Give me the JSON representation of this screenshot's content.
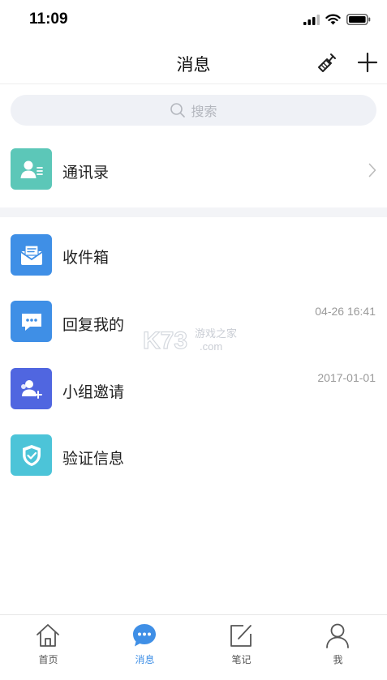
{
  "status_bar": {
    "time": "11:09"
  },
  "nav": {
    "title": "消息"
  },
  "search": {
    "placeholder": "搜索"
  },
  "contacts": {
    "label": "通讯录"
  },
  "messages": [
    {
      "label": "收件箱",
      "time": "",
      "icon": "inbox-icon",
      "color": "#3f8fe6"
    },
    {
      "label": "回复我的",
      "time": "04-26 16:41",
      "icon": "reply-chat-icon",
      "color": "#3f8fe6"
    },
    {
      "label": "小组邀请",
      "time": "2017-01-01",
      "icon": "group-invite-icon",
      "color": "#5066e0"
    },
    {
      "label": "验证信息",
      "time": "",
      "icon": "shield-check-icon",
      "color": "#4cc4d8"
    }
  ],
  "watermark": {
    "brand": "K73",
    "cn": "游戏之家",
    "domain": ".com"
  },
  "tabs": [
    {
      "label": "首页",
      "icon": "home-icon",
      "active": false
    },
    {
      "label": "消息",
      "icon": "message-icon",
      "active": true
    },
    {
      "label": "笔记",
      "icon": "note-icon",
      "active": false
    },
    {
      "label": "我",
      "icon": "user-icon",
      "active": false
    }
  ],
  "colors": {
    "accent": "#3f8fe6",
    "contacts_icon": "#5cc7b8",
    "search_bg": "#eff1f6"
  }
}
